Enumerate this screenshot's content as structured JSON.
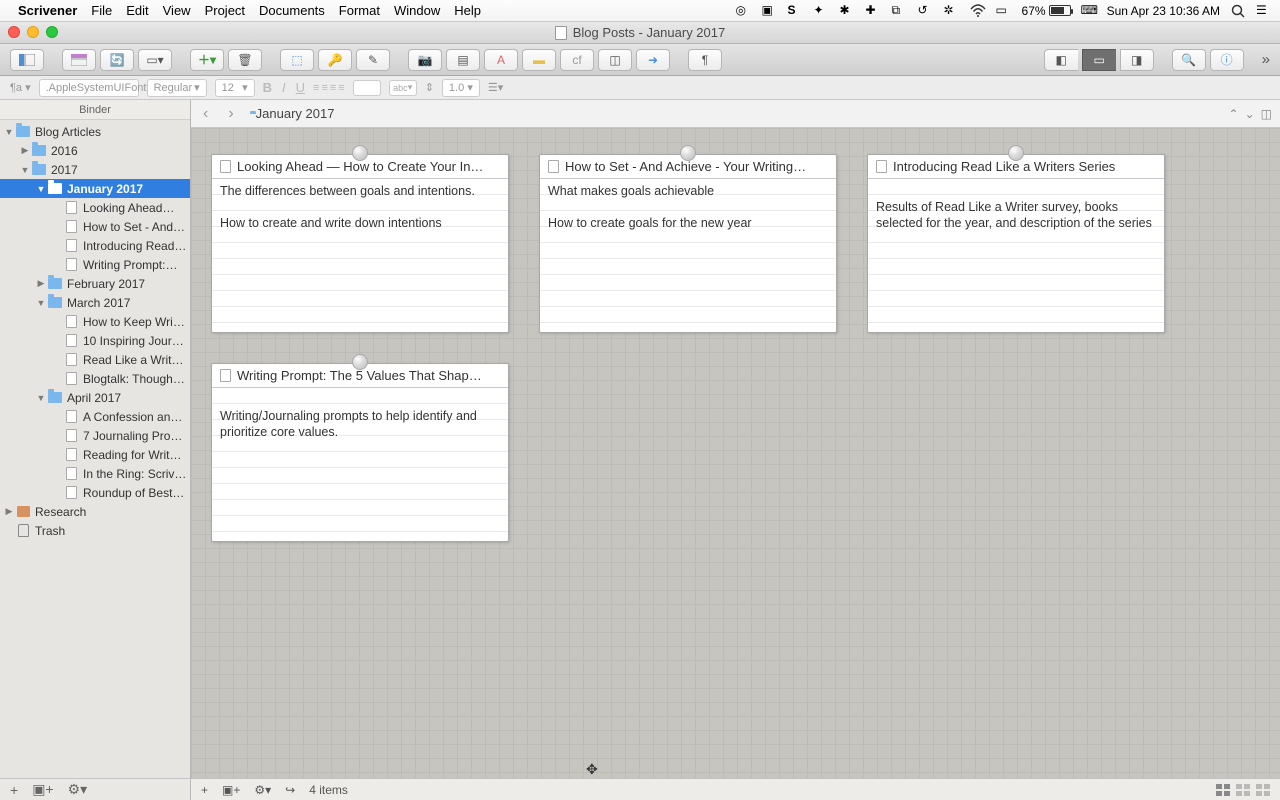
{
  "menubar": {
    "app": "Scrivener",
    "items": [
      "File",
      "Edit",
      "View",
      "Project",
      "Documents",
      "Format",
      "Window",
      "Help"
    ],
    "battery": "67%",
    "clock": "Sun Apr 23  10:36 AM"
  },
  "window": {
    "title": "Blog Posts - January 2017"
  },
  "formatbar": {
    "font": ".AppleSystemUIFont",
    "style": "Regular",
    "size": "12",
    "spacing": "1.0",
    "highlight": "abc"
  },
  "binder": {
    "header": "Binder",
    "tree": [
      {
        "indent": 0,
        "disc": "▼",
        "icon": "folder",
        "label": "Blog Articles",
        "bold": false
      },
      {
        "indent": 1,
        "disc": "▶",
        "icon": "folder",
        "label": "2016"
      },
      {
        "indent": 1,
        "disc": "▼",
        "icon": "folder",
        "label": "2017"
      },
      {
        "indent": 2,
        "disc": "▼",
        "icon": "folder",
        "label": "January 2017",
        "sel": true,
        "bold": true
      },
      {
        "indent": 3,
        "disc": "",
        "icon": "doc",
        "label": "Looking Ahead…"
      },
      {
        "indent": 3,
        "disc": "",
        "icon": "doc",
        "label": "How to Set - And…"
      },
      {
        "indent": 3,
        "disc": "",
        "icon": "doc",
        "label": "Introducing Read…"
      },
      {
        "indent": 3,
        "disc": "",
        "icon": "doc",
        "label": "Writing Prompt:…"
      },
      {
        "indent": 2,
        "disc": "▶",
        "icon": "folder",
        "label": "February 2017"
      },
      {
        "indent": 2,
        "disc": "▼",
        "icon": "folder",
        "label": "March 2017"
      },
      {
        "indent": 3,
        "disc": "",
        "icon": "doc",
        "label": "How to Keep Wri…"
      },
      {
        "indent": 3,
        "disc": "",
        "icon": "doc",
        "label": "10 Inspiring Jour…"
      },
      {
        "indent": 3,
        "disc": "",
        "icon": "doc",
        "label": "Read Like a Writ…"
      },
      {
        "indent": 3,
        "disc": "",
        "icon": "doc",
        "label": "Blogtalk: Though…"
      },
      {
        "indent": 2,
        "disc": "▼",
        "icon": "folder",
        "label": "April 2017"
      },
      {
        "indent": 3,
        "disc": "",
        "icon": "doc",
        "label": "A Confession an…"
      },
      {
        "indent": 3,
        "disc": "",
        "icon": "doc",
        "label": "7 Journaling Pro…"
      },
      {
        "indent": 3,
        "disc": "",
        "icon": "doc",
        "label": "Reading for Writ…"
      },
      {
        "indent": 3,
        "disc": "",
        "icon": "doc",
        "label": "In the Ring: Scriv…"
      },
      {
        "indent": 3,
        "disc": "",
        "icon": "doc",
        "label": "Roundup of Best…"
      },
      {
        "indent": 0,
        "disc": "▶",
        "icon": "research",
        "label": "Research"
      },
      {
        "indent": 0,
        "disc": "",
        "icon": "trash",
        "label": "Trash"
      }
    ]
  },
  "navbar": {
    "crumb": "January 2017"
  },
  "cards": [
    {
      "title": "Looking Ahead — How to Create Your In…",
      "lines": [
        "The differences between goals and intentions.",
        "How to create and write down intentions"
      ]
    },
    {
      "title": "How to Set - And Achieve - Your Writing…",
      "lines": [
        "What makes goals achievable",
        "How to create goals for the new year"
      ]
    },
    {
      "title": "Introducing Read Like a Writers Series",
      "lines": [
        "",
        "Results of Read Like a Writer survey, books selected for the year, and description of the series"
      ]
    },
    {
      "title": "Writing Prompt: The 5 Values That Shap…",
      "lines": [
        "",
        "Writing/Journaling prompts to help identify and prioritize core values."
      ]
    }
  ],
  "footer": {
    "count": "4 items"
  }
}
